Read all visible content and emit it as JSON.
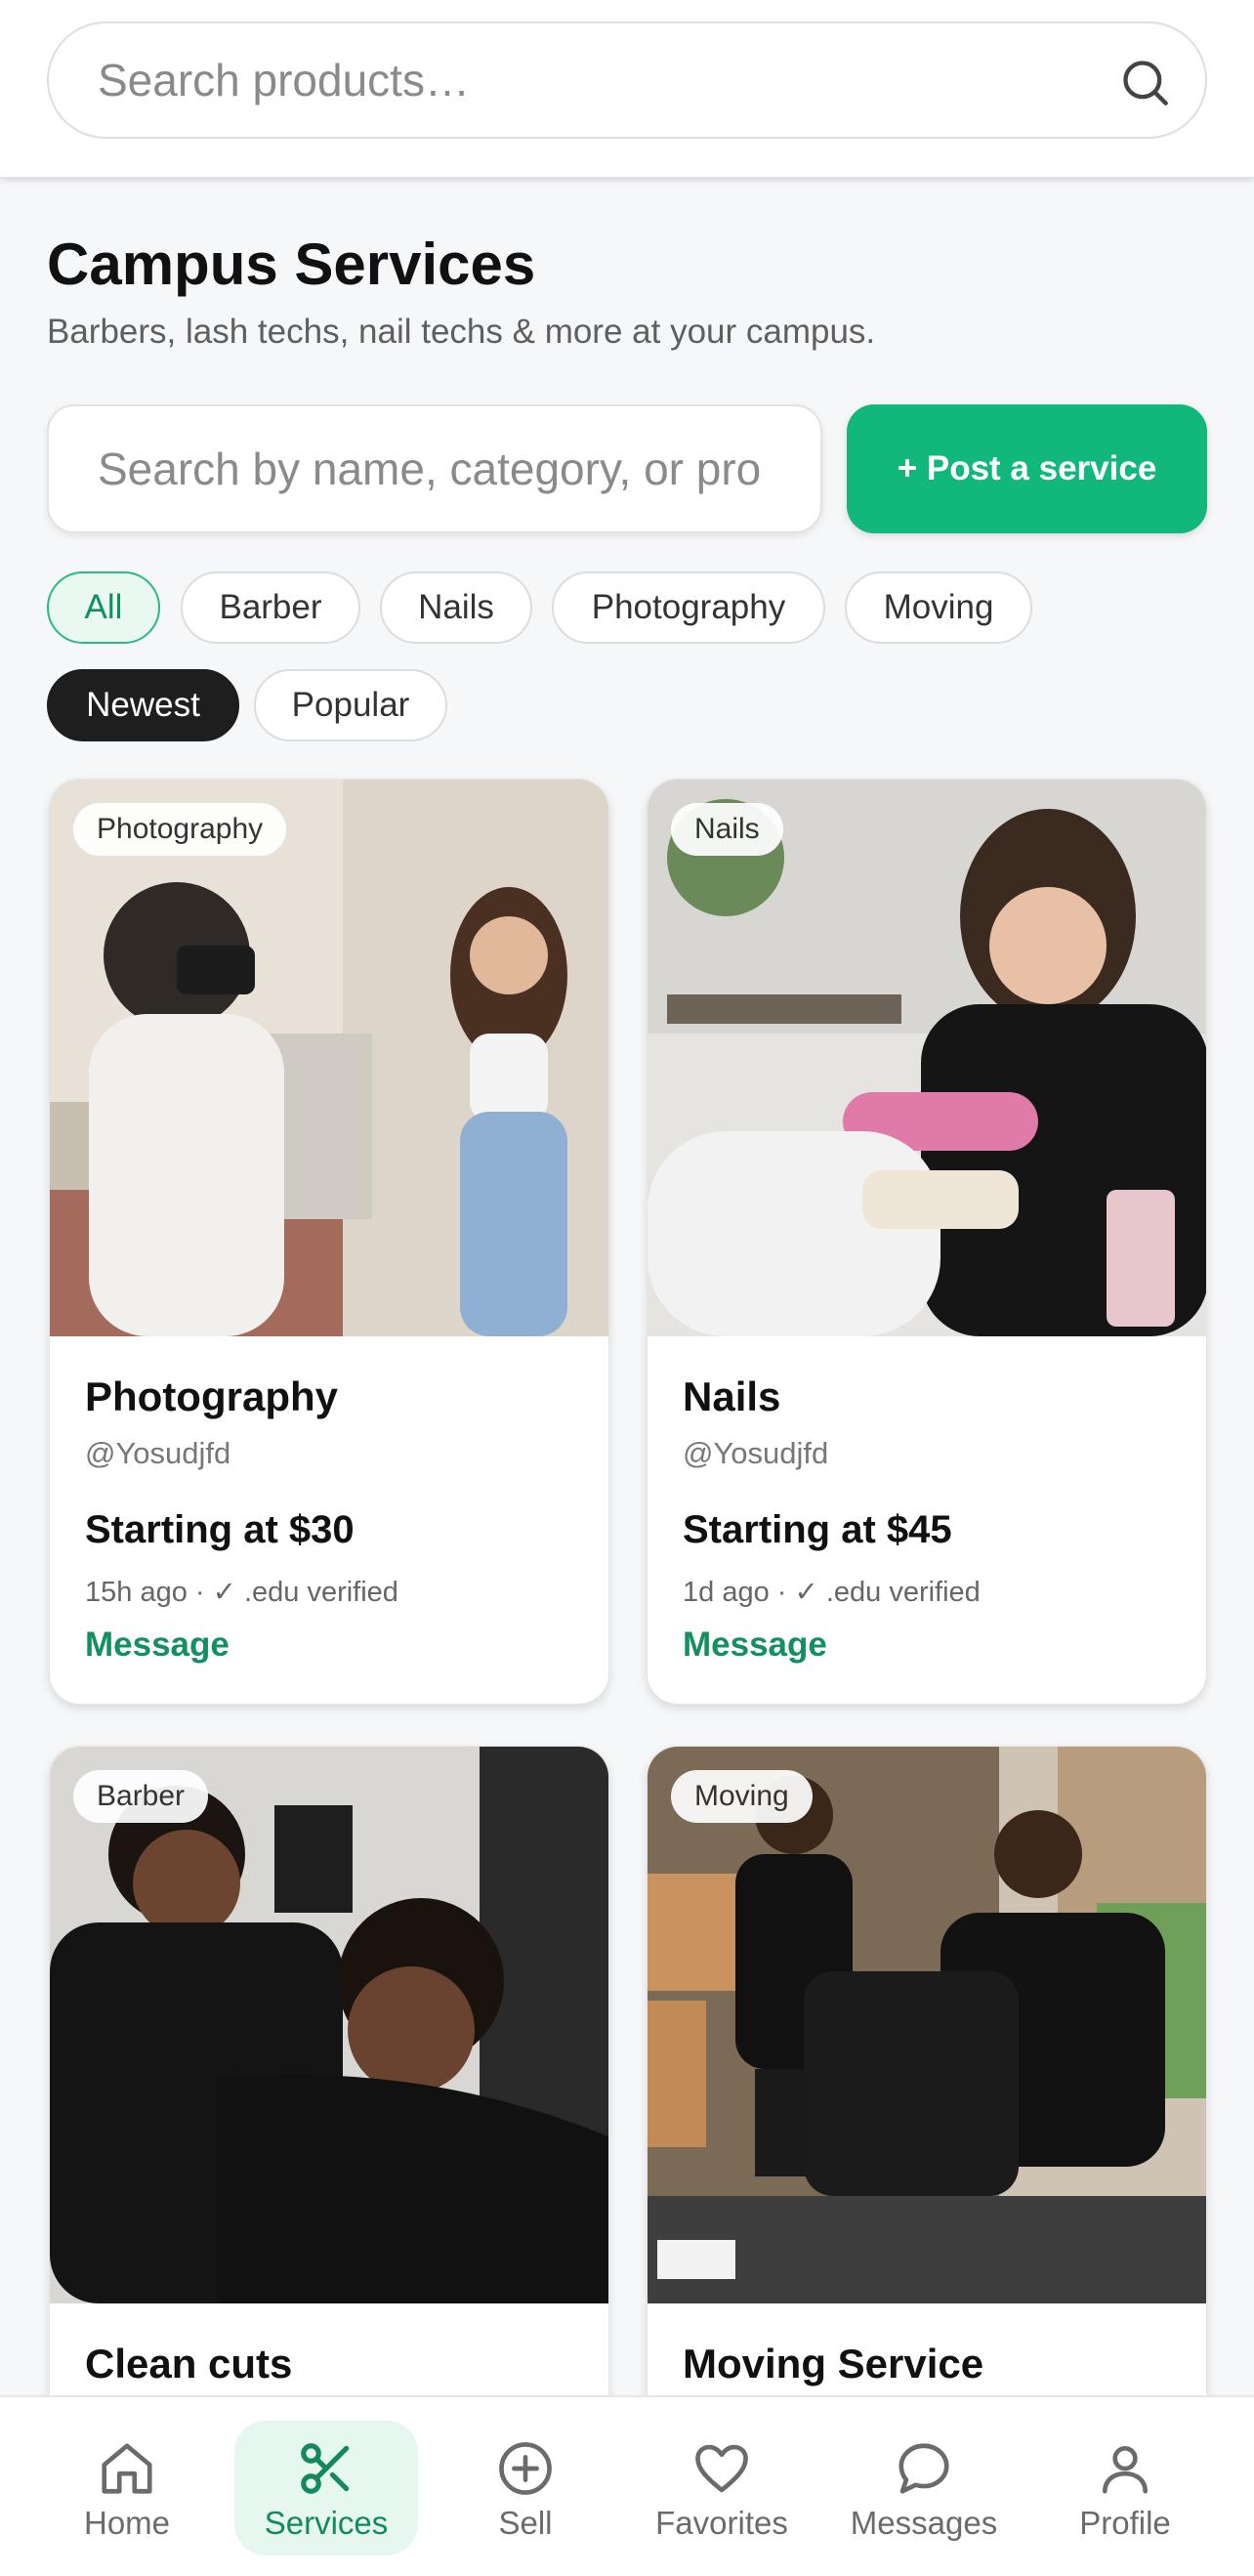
{
  "top_search": {
    "placeholder": "Search products…",
    "icon": "search-icon"
  },
  "header": {
    "title": "Campus Services",
    "subtitle": "Barbers, lash techs, nail techs & more at your campus."
  },
  "service_search": {
    "placeholder": "Search by name, category, or pro"
  },
  "post_button": {
    "label": "+ Post a service"
  },
  "category_chips": [
    {
      "label": "All",
      "active": true
    },
    {
      "label": "Barber",
      "active": false
    },
    {
      "label": "Nails",
      "active": false
    },
    {
      "label": "Photography",
      "active": false
    },
    {
      "label": "Moving",
      "active": false
    }
  ],
  "sort_chips": [
    {
      "label": "Newest",
      "active": true
    },
    {
      "label": "Popular",
      "active": false
    }
  ],
  "cards": [
    {
      "badge": "Photography",
      "title": "Photography",
      "user": "@Yosudjfd",
      "price": "Starting at $30",
      "meta": "15h ago · ✓ .edu verified",
      "action": "Message"
    },
    {
      "badge": "Nails",
      "title": "Nails",
      "user": "@Yosudjfd",
      "price": "Starting at $45",
      "meta": "1d ago · ✓ .edu verified",
      "action": "Message"
    },
    {
      "badge": "Barber",
      "title": "Clean cuts",
      "user": "",
      "price": "",
      "meta": "",
      "action": ""
    },
    {
      "badge": "Moving",
      "title": "Moving Service",
      "user": "",
      "price": "",
      "meta": "",
      "action": ""
    }
  ],
  "bottom_nav": [
    {
      "label": "Home",
      "icon": "home-icon",
      "active": false
    },
    {
      "label": "Services",
      "icon": "scissors-icon",
      "active": true
    },
    {
      "label": "Sell",
      "icon": "plus-circle-icon",
      "active": false
    },
    {
      "label": "Favorites",
      "icon": "heart-icon",
      "active": false
    },
    {
      "label": "Messages",
      "icon": "chat-bubble-icon",
      "active": false
    },
    {
      "label": "Profile",
      "icon": "user-icon",
      "active": false
    }
  ],
  "colors": {
    "accent": "#12b87b",
    "accent_text": "#148f5f",
    "dark_chip": "#1e1e1e"
  }
}
